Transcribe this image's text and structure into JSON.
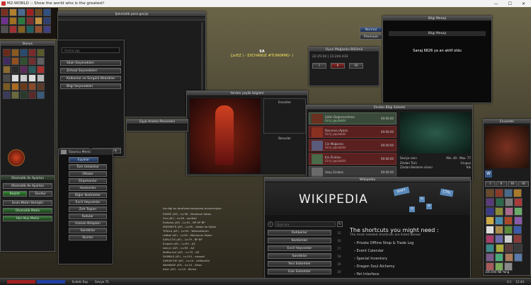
{
  "window": {
    "title": "M2-WORLD :: Show the world who is the greatest!",
    "minimize": "—",
    "maximize": "☐",
    "close": "✕"
  },
  "character": {
    "guild": "SA",
    "name": "ÇerEZ ( - EXCHANGE #TURKMMO- )"
  },
  "top_left_window": {
    "title": "Şekmatik para geçişi"
  },
  "search_panel": {
    "placeholder": "Arama yap",
    "dropdowns": [
      "Silah Seçenekleri",
      "Zırhsal Seçenekleri",
      "Kalkanlar ve Sürgülü Bilezikler",
      "Bilgi Seçenekleri"
    ],
    "clear_button": "Temizle",
    "search_button": "Öğrenim ara"
  },
  "left_panel": {
    "title": "Bonus",
    "action_label": "Otomatik Av Ayarları",
    "start_button": "Başlat",
    "stop_button": "Durdur",
    "tools_label": "Sıralı Metin Yerleştir",
    "auto_buttons": [
      "Otomatik Metin",
      "Akıl Akış Metin"
    ]
  },
  "info_box": {
    "buttons": [
      "Normal",
      "Premium"
    ],
    "title": "Bilgi Mesajı",
    "message": "Sanaj 6826 ya an aktif oldu"
  },
  "shop_window": {
    "title": "Oyun Mağazası Bölümü",
    "code": "22:25:04 | 12:244.433"
  },
  "menu_panel": {
    "title": "Oyuncu Menü",
    "items": [
      "Eşyalar",
      "Tüm Ustalıklar",
      "Oltalar",
      "Ekipmanlar",
      "Hostoniler",
      "Diğer Kostümler",
      "Evcil Hayvanlar",
      "Zırh Taşları",
      "Kutular",
      "Uzman Kitapları",
      "Sandıklar",
      "İksirler"
    ]
  },
  "chat_lines": [
    "Avcılığı bu tarafında karşılama bulunmuştur.",
    "EXKEE (AF) - Lv:99 - Maxiham Satan",
    "Zce (AF) - Lv:99 - seriSali",
    "ExXbros (AF) - Lv:91 - BP HP BP",
    "IRATINETS (AF) - Lv:95 - Alkolo ile Satan",
    "TEXILA (AF) - Lv:95 - Yeteneklerim",
    "reifbel (AF) - Lv:95 - Maximum Satan",
    "SARLCOS (AF) - Lv:79 - BP BP",
    "Exlpoel (AF) - Lv:93 - AZ",
    "tahry1 (AF) - Lv:93 - AZ",
    "KetBurns4 (AF) - Lv:75 - AZ",
    "DUMBLE (AF) - Lv:101 - ariasali",
    "Zeff4ECHE (AF) - Lv:10 - ckRbonEd",
    "WarWAVE (AF) - Lv:10 - Ahaa",
    "Icker (AF) - Lv:10 - Bichio"
  ],
  "character_window": {
    "title": "Yardım yeşlik bilgileri",
    "equip_label": "Envanter",
    "bonus_label": "Bonuslar"
  },
  "item_window": {
    "title": "Eşya Arama Penceresi"
  },
  "dungeon_window": {
    "title": "Zindan Bilgi Sistemi",
    "entries": [
      {
        "name": "Zafer Değerlendirme",
        "sub": "Giriş yapılabilir",
        "time": "00:00:00"
      },
      {
        "name": "Kavurucu Ayaza",
        "sub": "Giriş yapılabilir",
        "time": "00:00:00"
      },
      {
        "name": "Cin Mağarası",
        "sub": "Giriş yapılabilir",
        "time": "00:00:00"
      },
      {
        "name": "Kin Zindanı",
        "sub": "Giriş yapılabilir",
        "time": "00:00:00"
      },
      {
        "name": "Uzay Zındanı",
        "sub": "",
        "time": "00:00:00"
      }
    ],
    "details": [
      [
        "Seviye sınırı",
        "Min. 40 - Max. 77"
      ],
      [
        "Zindan Türü",
        "Grupça"
      ],
      [
        "Zindan Bekleme süresi",
        "Yok"
      ]
    ]
  },
  "wiki_window": {
    "title": "Wikipedia",
    "logo": "WIKIPEDIA",
    "search_placeholder": "Eşya ara",
    "categories": [
      "Rehberler",
      "Kostümler",
      "Evcil Hayvanlar",
      "Sandıklar",
      "Yeni Sistemler",
      "Eski Sistemler"
    ],
    "num_buttons": [
      "15",
      "16",
      "17",
      "18",
      "19",
      "20"
    ],
    "keys": [
      "SHIFT",
      "CTRL",
      "G",
      "H",
      "O"
    ],
    "heading": "The shortcuts you might need :",
    "subheading": "The most needed shortcuts are listed below!",
    "links": [
      "Private Offline Shop & Trade Log",
      "Event Calendar",
      "Special Inventory",
      "Dragon Soul Alchemy",
      "Pet Interface"
    ]
  },
  "inventory": {
    "title": "Envanter",
    "badge": "W",
    "money": "100.000 NB Yang",
    "pages": [
      "I",
      "II",
      "III",
      "IV"
    ]
  },
  "status_bar": {
    "exp": "Evdeki Exp",
    "level": "Seviye 75",
    "time": "12:44",
    "speed": "0.1"
  }
}
